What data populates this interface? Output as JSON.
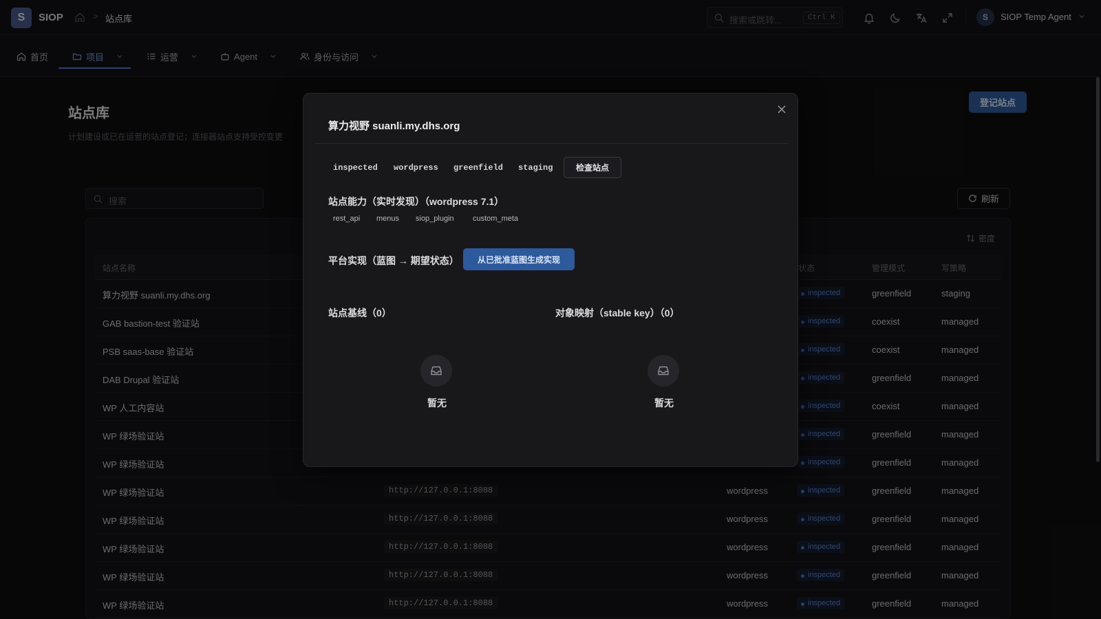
{
  "topbar": {
    "logo_letter": "S",
    "brand": "SIOP",
    "breadcrumb_sep": ">",
    "breadcrumb_current": "站点库",
    "search_placeholder": "搜索或跳转...",
    "search_shortcut": "Ctrl K",
    "icons": [
      "bell-icon",
      "moon-icon",
      "translate-icon",
      "fullscreen-icon"
    ],
    "user_avatar": "S",
    "user_name": "SIOP Temp Agent"
  },
  "nav": {
    "items": [
      {
        "label": "首页",
        "icon": "home-icon",
        "active": false
      },
      {
        "label": "项目",
        "icon": "folder-icon",
        "active": true
      },
      {
        "label": "运营",
        "icon": "list-icon",
        "active": false
      },
      {
        "label": "Agent",
        "icon": "robot-icon",
        "active": false
      },
      {
        "label": "身份与访问",
        "icon": "users-icon",
        "active": false
      }
    ]
  },
  "page": {
    "title": "站点库",
    "description": "计划建设或已在运营的站点登记；连接器站点支持受控变更",
    "register_button": "登记站点",
    "search_placeholder": "搜索",
    "refresh_button": "刷新",
    "density_button": "密度"
  },
  "table": {
    "columns": {
      "name": "站点名称",
      "status": "状态",
      "mode": "管理模式",
      "policy": "写策略"
    },
    "rows": [
      {
        "name": "算力视野 suanli.my.dhs.org",
        "url": "",
        "platform": "",
        "status": "inspected",
        "mode": "greenfield",
        "policy": "staging"
      },
      {
        "name": "GAB bastion-test 验证站",
        "url": "",
        "platform": "",
        "status": "inspected",
        "mode": "coexist",
        "policy": "managed"
      },
      {
        "name": "PSB saas-base 验证站",
        "url": "",
        "platform": "",
        "status": "inspected",
        "mode": "coexist",
        "policy": "managed"
      },
      {
        "name": "DAB Drupal 验证站",
        "url": "",
        "platform": "",
        "status": "inspected",
        "mode": "greenfield",
        "policy": "managed"
      },
      {
        "name": "WP 人工内容站",
        "url": "",
        "platform": "",
        "status": "inspected",
        "mode": "coexist",
        "policy": "managed"
      },
      {
        "name": "WP 绿场验证站",
        "url": "",
        "platform": "",
        "status": "inspected",
        "mode": "greenfield",
        "policy": "managed"
      },
      {
        "name": "WP 绿场验证站",
        "url": "",
        "platform": "",
        "status": "inspected",
        "mode": "greenfield",
        "policy": "managed"
      },
      {
        "name": "WP 绿场验证站",
        "url": "http://127.0.0.1:8088",
        "platform": "wordpress",
        "status": "inspected",
        "mode": "greenfield",
        "policy": "managed"
      },
      {
        "name": "WP 绿场验证站",
        "url": "http://127.0.0.1:8088",
        "platform": "wordpress",
        "status": "inspected",
        "mode": "greenfield",
        "policy": "managed"
      },
      {
        "name": "WP 绿场验证站",
        "url": "http://127.0.0.1:8088",
        "platform": "wordpress",
        "status": "inspected",
        "mode": "greenfield",
        "policy": "managed"
      },
      {
        "name": "WP 绿场验证站",
        "url": "http://127.0.0.1:8088",
        "platform": "wordpress",
        "status": "inspected",
        "mode": "greenfield",
        "policy": "managed"
      },
      {
        "name": "WP 绿场验证站",
        "url": "http://127.0.0.1:8088",
        "platform": "wordpress",
        "status": "inspected",
        "mode": "greenfield",
        "policy": "managed"
      }
    ]
  },
  "modal": {
    "title": "算力视野 suanli.my.dhs.org",
    "tags": [
      "inspected",
      "wordpress",
      "greenfield",
      "staging"
    ],
    "inspect_button": "检查站点",
    "capabilities_title": "站点能力（实时发现）（wordpress 7.1）",
    "capabilities": [
      "rest_api",
      "menus",
      "siop_plugin",
      "custom_meta"
    ],
    "realization_title": "平台实现（蓝图 → 期望状态）",
    "generate_button": "从已批准蓝图生成实现",
    "baseline_title": "站点基线（0）",
    "mapping_title": "对象映射（stable key）（0）",
    "empty_text": "暂无"
  },
  "colors": {
    "accent": "#2d5a9c",
    "active_nav": "#7b93d6",
    "badge": "#5b7fcf"
  }
}
